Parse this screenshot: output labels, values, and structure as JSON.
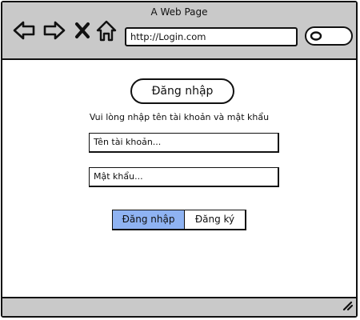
{
  "window": {
    "title": "A Web Page"
  },
  "browser": {
    "nav_icons": [
      "back-arrow-icon",
      "forward-arrow-icon",
      "close-x-icon",
      "home-icon"
    ],
    "url": "http://Login.com",
    "search_icon": "search-icon"
  },
  "login": {
    "title": "Đăng nhập",
    "instruction": "Vui lòng nhập tên tài khoản và mật khẩu",
    "username_placeholder": "Tên tài khoản...",
    "password_placeholder": "Mật khẩu...",
    "login_button": "Đăng nhập",
    "register_button": "Đăng ký"
  },
  "colors": {
    "chrome": "#c9c9c9",
    "primary_button": "#8fb3f2"
  }
}
